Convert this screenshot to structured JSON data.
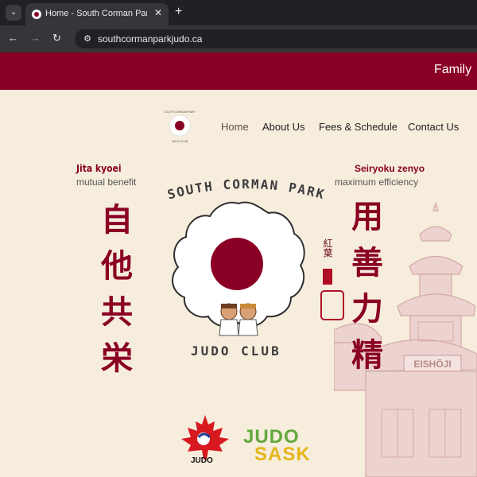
{
  "browser": {
    "tab_title": "Home - South Corman Park Judo Club",
    "url": "southcormanparkjudo.ca",
    "icons": [
      "tab-menu-icon",
      "close-icon",
      "plus-icon",
      "back-icon",
      "forward-icon",
      "reload-icon",
      "site-info-icon"
    ]
  },
  "banner": {
    "text": "Family"
  },
  "nav": {
    "items": [
      {
        "label": "Home",
        "active": true
      },
      {
        "label": "About Us"
      },
      {
        "label": "Fees & Schedule"
      },
      {
        "label": "Contact Us"
      }
    ]
  },
  "hero": {
    "left_title": "Jita kyoei",
    "left_subtitle": "mutual benefit",
    "right_title": "Seiryoku zenyo",
    "right_subtitle": "maximum efficiency",
    "left_kanji": [
      "自",
      "他",
      "共",
      "栄"
    ],
    "right_kanji": [
      "精",
      "力",
      "善",
      "用"
    ],
    "club_name_top": "SOUTH CORMAN PARK",
    "club_name_bottom": "JUDO CLUB",
    "temple_sign": "EISHŌJI",
    "small_kanji": "紅葉"
  },
  "sponsors": {
    "judo_canada": "JUDO",
    "judo_sask_top": "JUDO",
    "judo_sask_bottom": "SASK"
  },
  "colors": {
    "brand": "#8a0024",
    "background": "#f6eddd",
    "sask_green": "#63a83d",
    "sask_gold": "#e4b61a"
  }
}
